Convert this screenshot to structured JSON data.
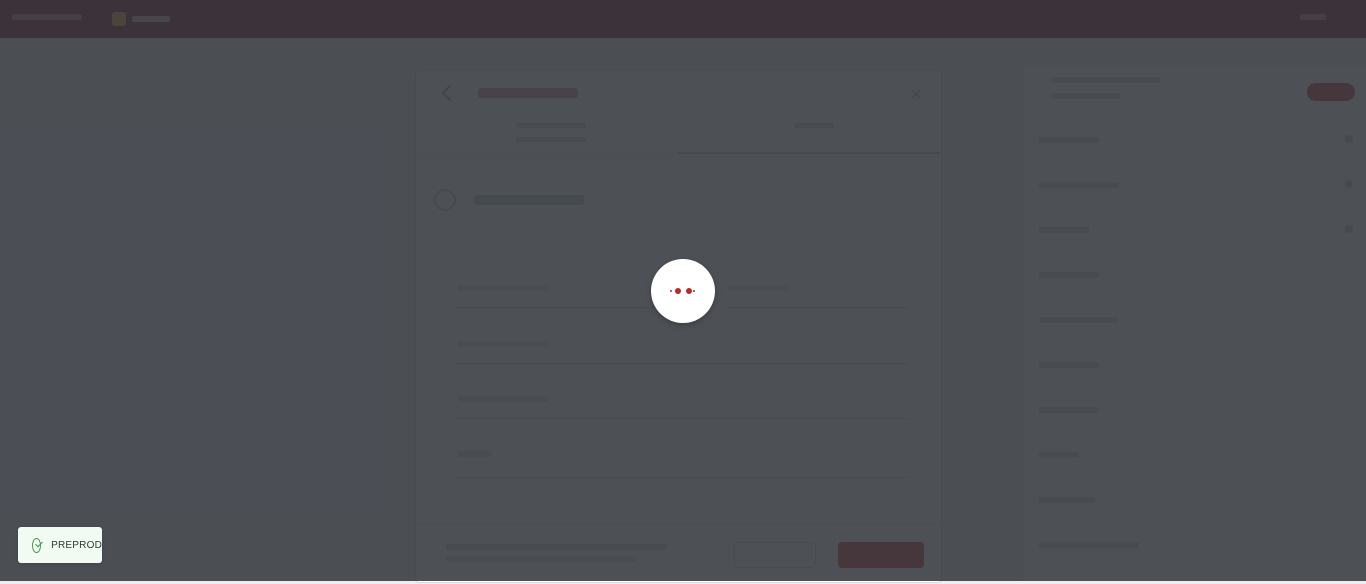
{
  "environment_badge": {
    "label": "PREPROD",
    "icon": "check-circle-icon",
    "color": "#3d9a4a"
  },
  "loader": {
    "icon": "loading-dots-icon",
    "color": "#b52a2a"
  },
  "colors": {
    "brand": "#8a2a3a",
    "accent": "#c94a4a",
    "overlay": "rgba(48,52,58,0.86)"
  }
}
